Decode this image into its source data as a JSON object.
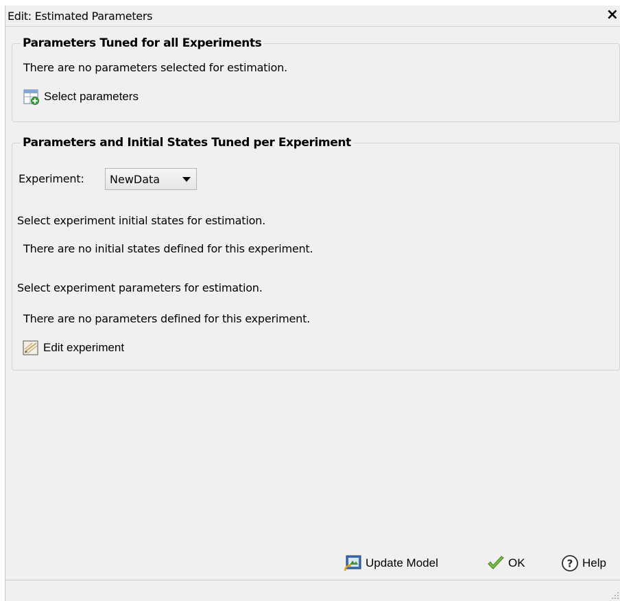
{
  "window": {
    "title": "Edit: Estimated Parameters",
    "close_symbol": "×"
  },
  "global_group": {
    "title": "Parameters Tuned for all Experiments",
    "message": "There are no parameters selected for estimation.",
    "select_parameters_label": "Select parameters",
    "select_parameters_icon": "select-parameters-icon"
  },
  "experiment_group": {
    "title": "Parameters and Initial States Tuned per Experiment",
    "experiment_label": "Experiment:",
    "experiment_value": "NewData",
    "initial_states_heading": "Select experiment initial states for estimation.",
    "initial_states_message": "There are no initial states defined for this experiment.",
    "parameters_heading": "Select experiment parameters for estimation.",
    "parameters_message": "There are no parameters defined for this experiment.",
    "edit_experiment_label": "Edit experiment",
    "edit_experiment_icon": "edit-experiment-icon"
  },
  "footer": {
    "update_model_label": "Update Model",
    "ok_label": "OK",
    "help_label": "Help"
  }
}
